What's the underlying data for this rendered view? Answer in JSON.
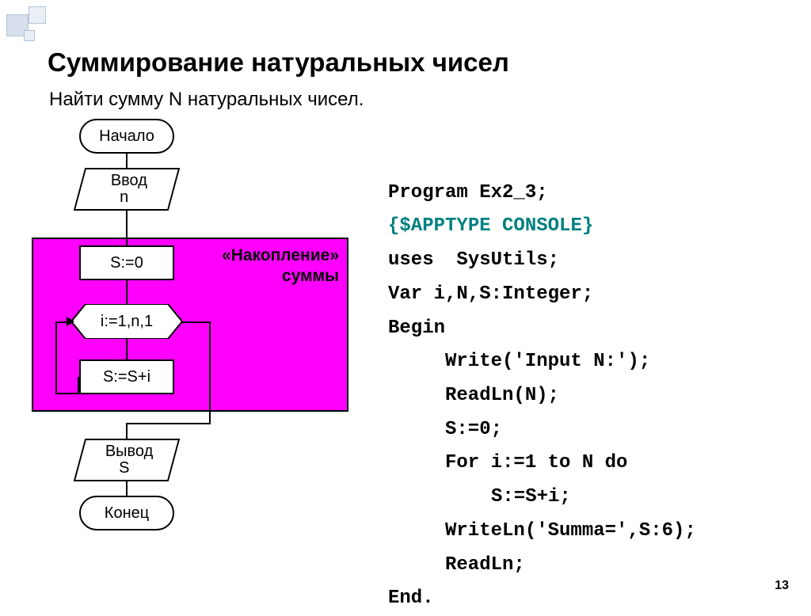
{
  "title": "Суммирование натуральных чисел",
  "subtitle": "Найти сумму N натуральных чисел.",
  "flow": {
    "start": "Начало",
    "input_l1": "Ввод",
    "input_l2": "n",
    "init": "S:=0",
    "loop": "i:=1,n,1",
    "body": "S:=S+i",
    "output_l1": "Вывод",
    "output_l2": "S",
    "end": "Конец",
    "magenta_l1": "«Накопление»",
    "magenta_l2": "суммы"
  },
  "code": {
    "l1": "Program Ex2_3;",
    "l2": "{$APPTYPE CONSOLE}",
    "l3": "uses  SysUtils;",
    "l4": "Var i,N,S:Integer;",
    "l5": "Begin",
    "l6": "Write('Input N:');",
    "l7": "ReadLn(N);",
    "l8": "S:=0;",
    "l9": "For i:=1 to N do",
    "l10": "S:=S+i;",
    "l11": "WriteLn('Summa=',S:6);",
    "l12": "ReadLn;",
    "l13": "End."
  },
  "pagenum": "13"
}
